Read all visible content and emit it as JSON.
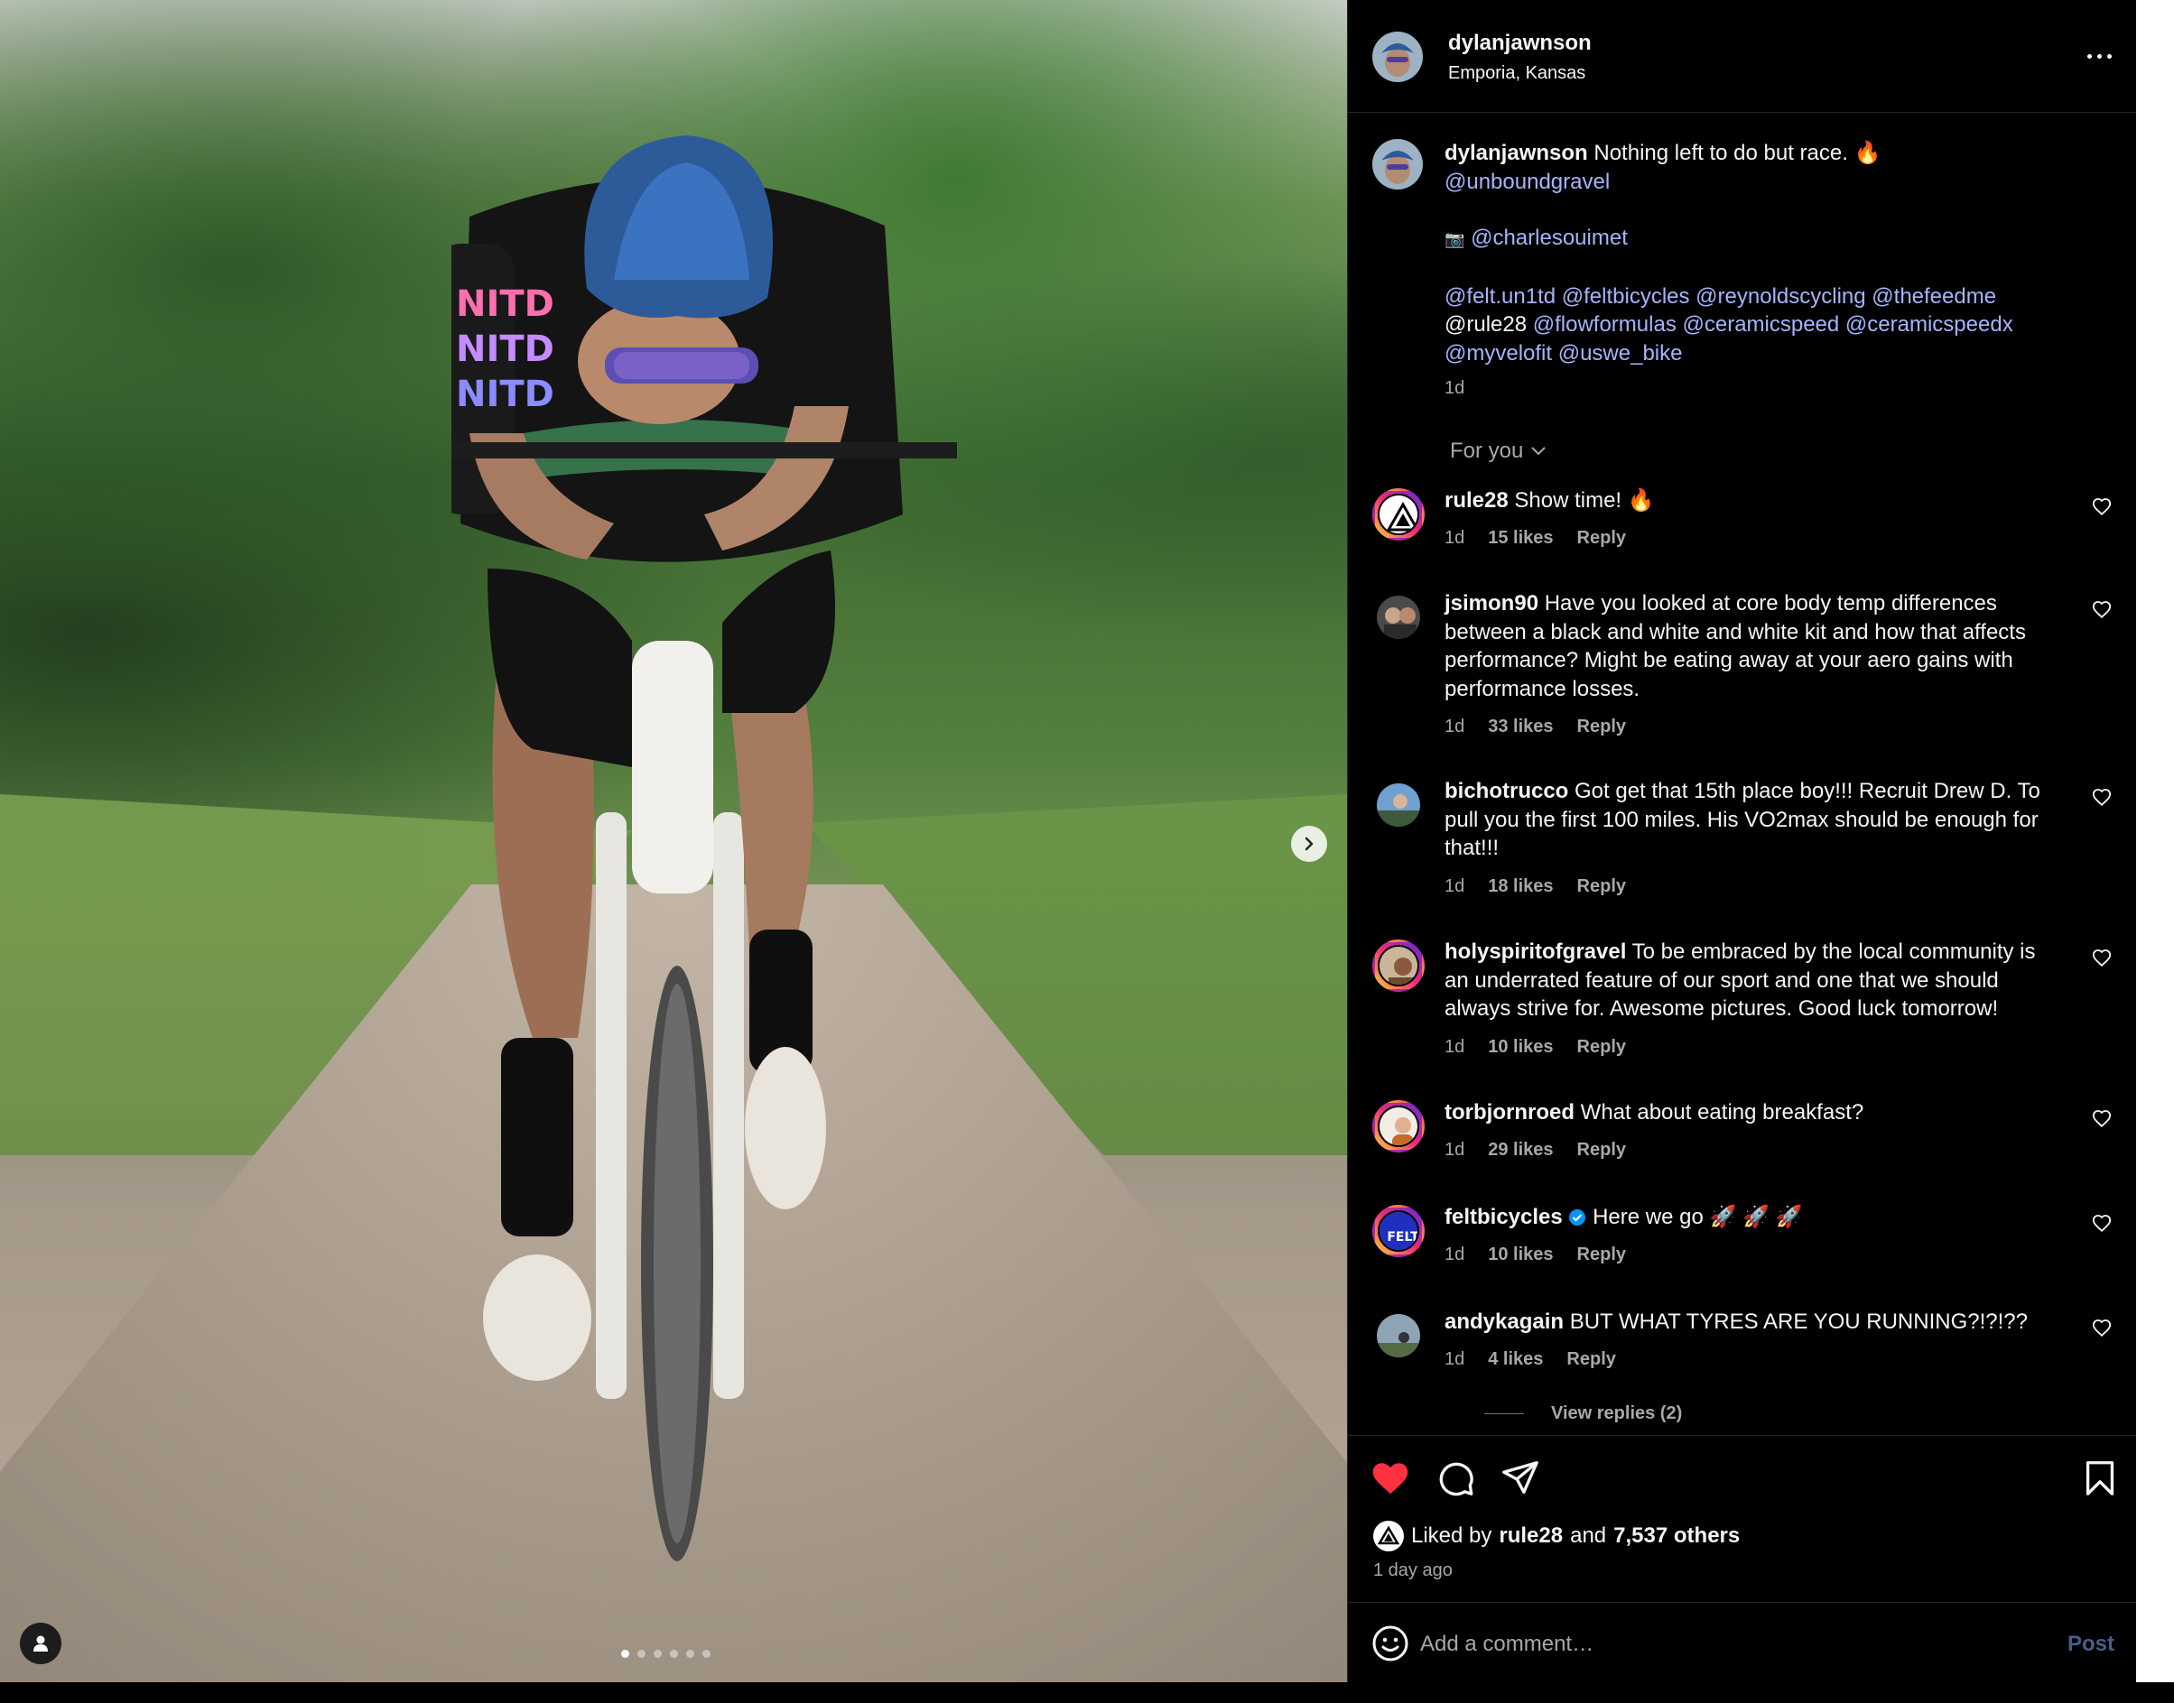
{
  "post": {
    "username": "dylanjawnson",
    "location": "Emporia, Kansas",
    "more_icon": "more-horizontal-icon",
    "caption": {
      "username": "dylanjawnson",
      "text": "Nothing left to do but race. 🔥",
      "mention_line1": "@unboundgravel",
      "camera": "📷",
      "photo_credit": "@charlesouimet",
      "tags_line1": "@felt.un1td @feltbicycles @reynoldscycling @thefeedme",
      "tags_line2_plain": "@rule28",
      "tags_line2_links": "@flowformulas @ceramicspeed @ceramicspeedx",
      "tags_line3": "@myvelofit @uswe_bike",
      "time": "1d"
    },
    "sort_label": "For you"
  },
  "comments": [
    {
      "username": "rule28",
      "text": "Show time! 🔥",
      "time": "1d",
      "likes": "15 likes",
      "reply": "Reply"
    },
    {
      "username": "jsimon90",
      "text": "Have you looked at core body temp differences between a black and white and white kit and how that affects performance? Might be eating away at your aero gains with performance losses.",
      "time": "1d",
      "likes": "33 likes",
      "reply": "Reply"
    },
    {
      "username": "bichotrucco",
      "text": "Got get that 15th place boy!!! Recruit Drew D. To pull you the first 100 miles. His VO2max should be enough for that!!!",
      "time": "1d",
      "likes": "18 likes",
      "reply": "Reply"
    },
    {
      "username": "holyspiritofgravel",
      "text": "To be embraced by the local community is an underrated feature of our sport and one that we should always strive for. Awesome pictures. Good luck tomorrow!",
      "time": "1d",
      "likes": "10 likes",
      "reply": "Reply"
    },
    {
      "username": "torbjornroed",
      "text": "What about eating breakfast?",
      "time": "1d",
      "likes": "29 likes",
      "reply": "Reply"
    },
    {
      "username": "feltbicycles",
      "verified": true,
      "text": "Here we go 🚀 🚀 🚀",
      "time": "1d",
      "likes": "10 likes",
      "reply": "Reply"
    },
    {
      "username": "andykagain",
      "text": "BUT WHAT TYRES ARE YOU RUNNING?!?!??",
      "time": "1d",
      "likes": "4 likes",
      "reply": "Reply",
      "view_replies": "View replies (2)"
    }
  ],
  "footer": {
    "liked_by_prefix": "Liked by",
    "liked_by_user": "rule28",
    "liked_by_mid": "and",
    "liked_by_others": "7,537 others",
    "posted_ago": "1 day ago",
    "comment_placeholder": "Add a comment…",
    "post_label": "Post",
    "liked": true
  },
  "carousel": {
    "slides": 6,
    "current": 1
  },
  "colors": {
    "accent_link": "#a5b4fc",
    "heart": "#ff3040",
    "post_disabled": "#4a5d8a",
    "verified": "#0095f6"
  }
}
